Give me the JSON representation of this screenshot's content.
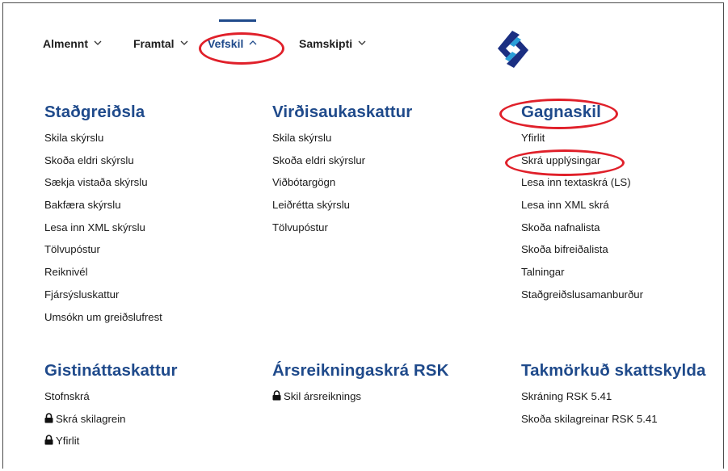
{
  "nav": {
    "items": [
      {
        "label": "Almennt"
      },
      {
        "label": "Framtal"
      },
      {
        "label": "Vefskil"
      },
      {
        "label": "Samskipti"
      }
    ]
  },
  "sections": {
    "stadgreidsla": {
      "title": "Staðgreiðsla",
      "links": [
        "Skila skýrslu",
        "Skoða eldri skýrslu",
        "Sækja vistaða skýrslu",
        "Bakfæra skýrslu",
        "Lesa inn XML skýrslu",
        "Tölvupóstur",
        "Reiknivél",
        "Fjársýsluskattur",
        "Umsókn um greiðslufrest"
      ]
    },
    "virdisauki": {
      "title": "Virðisaukaskattur",
      "links": [
        "Skila skýrslu",
        "Skoða eldri skýrslur",
        "Viðbótargögn",
        "Leiðrétta skýrslu",
        "Tölvupóstur"
      ]
    },
    "gagnaskil": {
      "title": "Gagnaskil",
      "links": [
        "Yfirlit",
        "Skrá upplýsingar",
        "Lesa inn textaskrá (LS)",
        "Lesa inn XML skrá",
        "Skoða nafnalista",
        "Skoða bifreiðalista",
        "Talningar",
        "Staðgreiðslusamanburður"
      ]
    },
    "gistinatt": {
      "title": "Gistináttaskattur",
      "links": [
        "Stofnskrá",
        "Skrá skilagrein",
        "Yfirlit"
      ]
    },
    "arsreikning": {
      "title": "Ársreikningaskrá RSK",
      "links": [
        "Skil ársreiknings"
      ]
    },
    "takmorkud": {
      "title": "Takmörkuð skattskylda",
      "links": [
        "Skráning RSK 5.41",
        "Skoða skilagreinar RSK 5.41"
      ]
    }
  },
  "colors": {
    "heading": "#1f4a8b",
    "annotation": "#e0202a",
    "logo_dark": "#1b2f82",
    "logo_light": "#2a9fd8"
  }
}
